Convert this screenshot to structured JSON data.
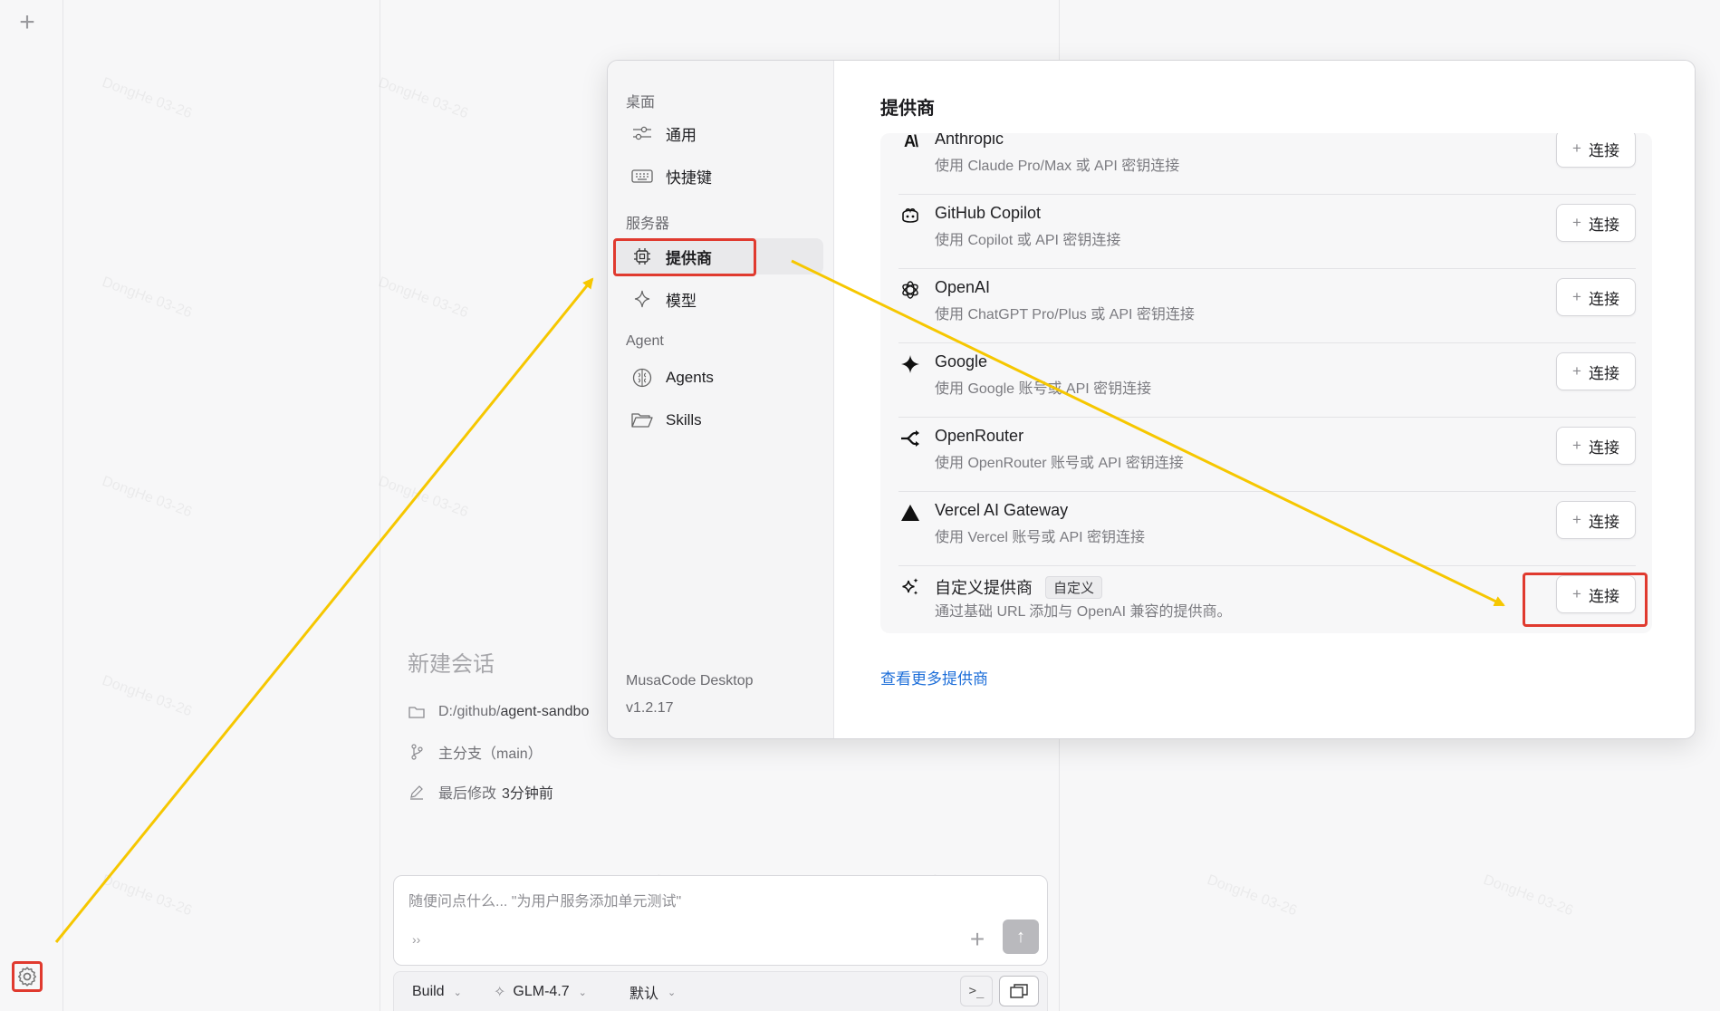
{
  "rail": {
    "new_icon": "plus-icon",
    "settings_icon": "gear-icon"
  },
  "session": {
    "title": "新建会话",
    "path_prefix": "D:/github/",
    "path_name": "agent-sandbo",
    "branch_label": "主分支（main）",
    "modified_label": "最后修改",
    "modified_value": "3分钟前"
  },
  "composer": {
    "placeholder": "随便问点什么... \"为用户服务添加单元测试\"",
    "chevron": "››",
    "plus": "+",
    "send": "↑"
  },
  "toolbar": {
    "mode": "Build",
    "model": "GLM-4.7",
    "variant": "默认",
    "terminal": ">_"
  },
  "dialog": {
    "sidebar": {
      "sections": [
        {
          "title": "桌面",
          "items": [
            {
              "label": "通用",
              "icon": "sliders-icon"
            },
            {
              "label": "快捷键",
              "icon": "keyboard-icon"
            }
          ]
        },
        {
          "title": "服务器",
          "items": [
            {
              "label": "提供商",
              "icon": "chip-icon"
            },
            {
              "label": "模型",
              "icon": "sparkle-icon"
            }
          ]
        },
        {
          "title": "Agent",
          "items": [
            {
              "label": "Agents",
              "icon": "brain-icon"
            },
            {
              "label": "Skills",
              "icon": "folder-icon"
            }
          ]
        }
      ],
      "active": "提供商",
      "app_name": "MusaCode Desktop",
      "version": "v1.2.17"
    },
    "heading": "提供商",
    "connect_label": "连接",
    "providers": [
      {
        "name": "Anthropic",
        "desc": "使用 Claude Pro/Max 或 API 密钥连接",
        "icon": "anthropic-icon"
      },
      {
        "name": "GitHub Copilot",
        "desc": "使用 Copilot 或 API 密钥连接",
        "icon": "copilot-icon"
      },
      {
        "name": "OpenAI",
        "desc": "使用 ChatGPT Pro/Plus 或 API 密钥连接",
        "icon": "openai-icon"
      },
      {
        "name": "Google",
        "desc": "使用 Google 账号或 API 密钥连接",
        "icon": "google-gemini-icon"
      },
      {
        "name": "OpenRouter",
        "desc": "使用 OpenRouter 账号或 API 密钥连接",
        "icon": "openrouter-icon"
      },
      {
        "name": "Vercel AI Gateway",
        "desc": "使用 Vercel 账号或 API 密钥连接",
        "icon": "vercel-icon"
      },
      {
        "name": "自定义提供商",
        "tag": "自定义",
        "desc": "通过基础 URL 添加与 OpenAI 兼容的提供商。",
        "icon": "custom-sparkles-icon"
      }
    ],
    "more_link": "查看更多提供商"
  },
  "watermark": "DongHe 03-26",
  "colors": {
    "annotation_arrow": "#f6c700",
    "annotation_box": "#e03a2f",
    "link": "#1e6fd9"
  }
}
